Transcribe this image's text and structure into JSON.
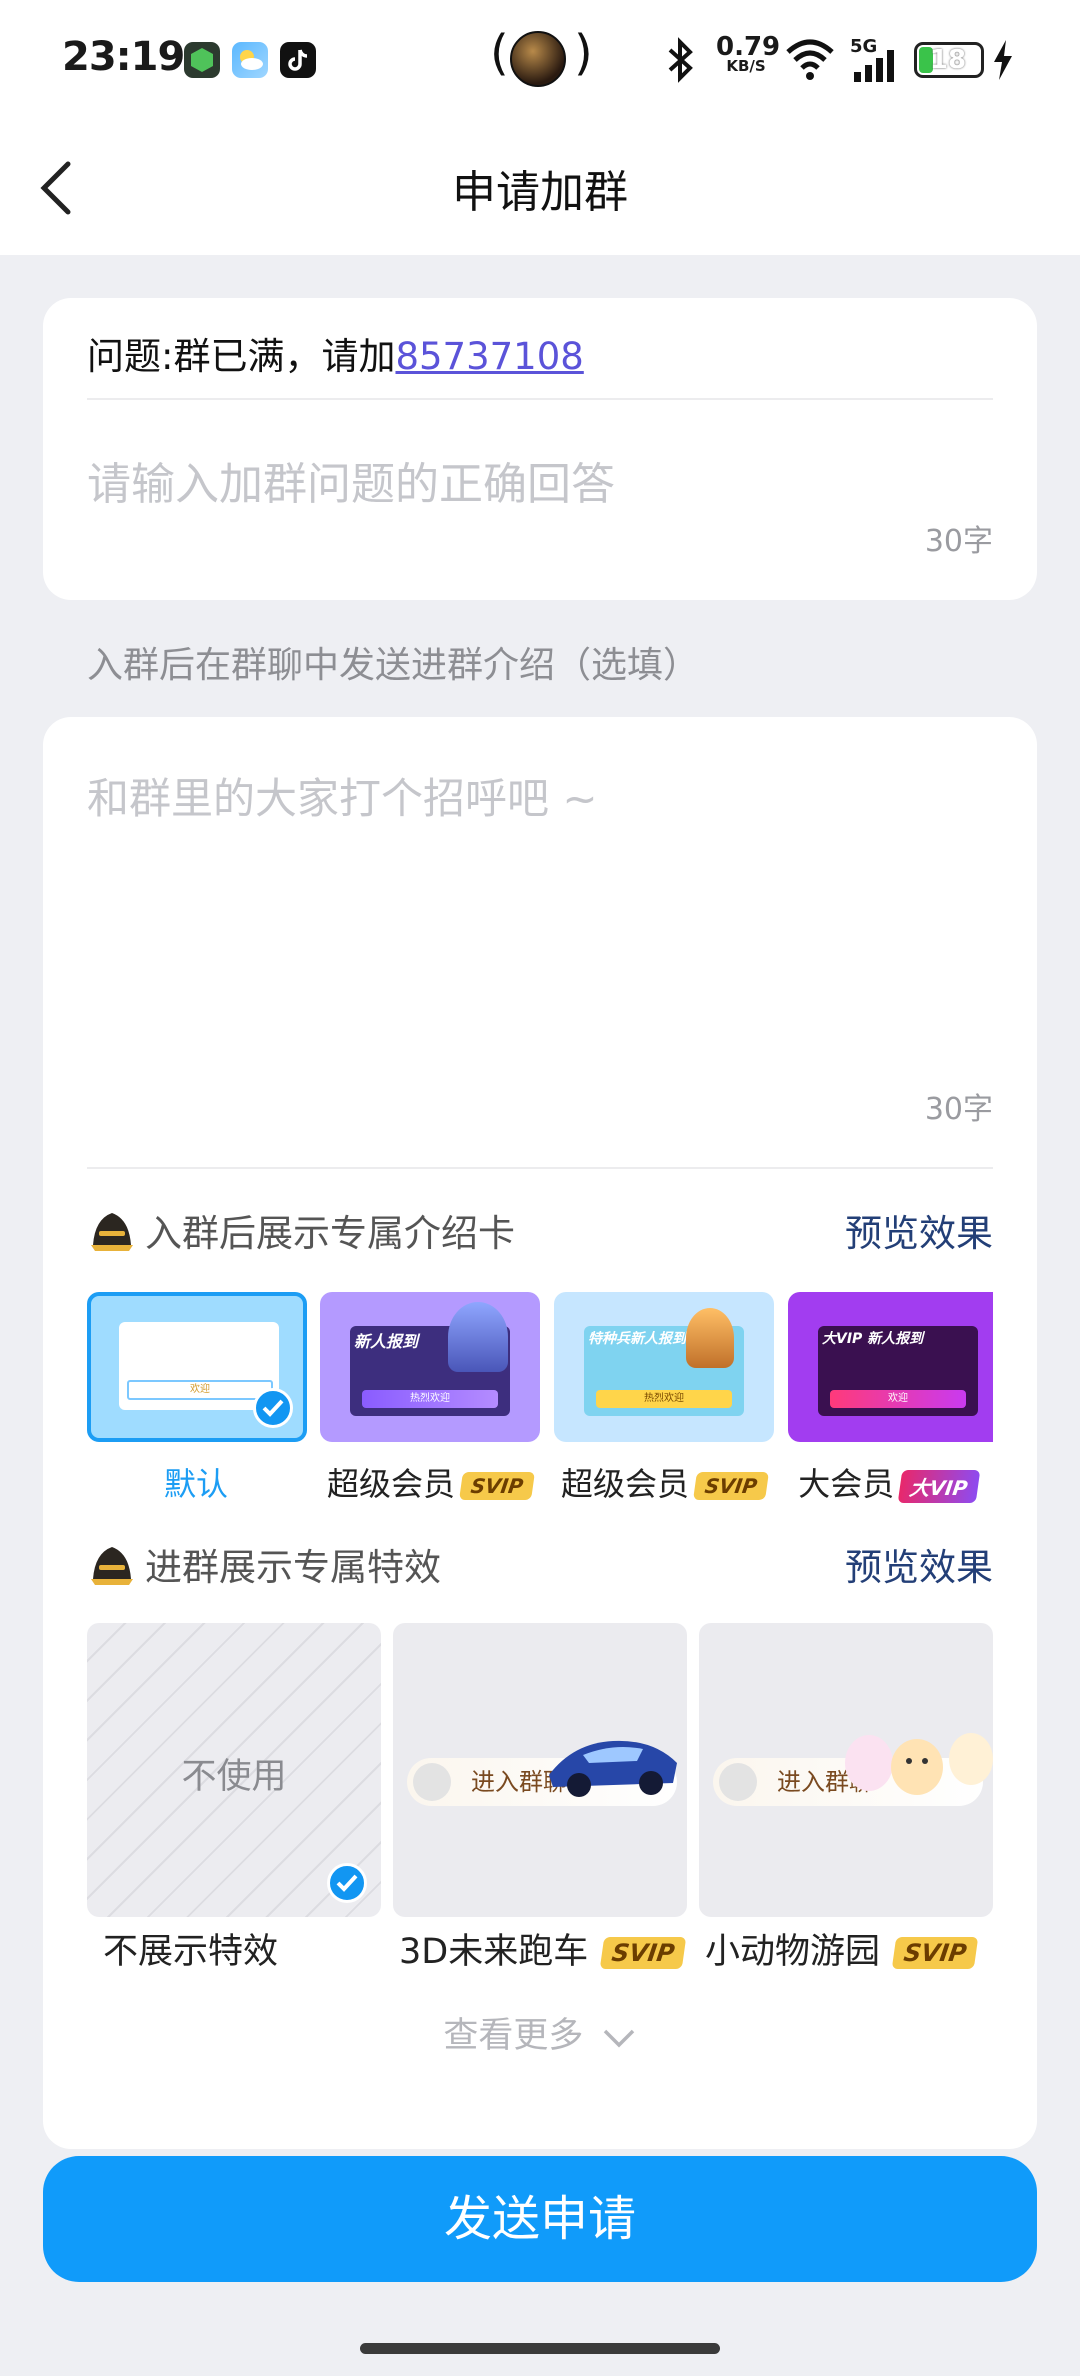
{
  "status_bar": {
    "time": "23:19",
    "speed_value": "0.79",
    "speed_unit": "KB/S",
    "network": "5G",
    "battery": "18"
  },
  "header": {
    "title": "申请加群"
  },
  "question_card": {
    "question_prefix": "问题:群已满，请加",
    "question_link": "85737108",
    "answer_placeholder": "请输入加群问题的正确回答",
    "answer_counter": "30字"
  },
  "intro_hint": "入群后在群聊中发送进群介绍（选填）",
  "intro_card": {
    "message_placeholder": "和群里的大家打个招呼吧 ~",
    "message_counter": "30字",
    "intro_card_section": {
      "title": "入群后展示专属介绍卡",
      "preview": "预览效果",
      "options": [
        {
          "label": "默认",
          "badge": "",
          "selected": true,
          "banner": "",
          "btn": "欢迎"
        },
        {
          "label": "超级会员",
          "badge": "SVIP",
          "banner": "新人报到",
          "btn": "热烈欢迎"
        },
        {
          "label": "超级会员",
          "badge": "SVIP",
          "banner": "特种兵新人报到",
          "btn": "热烈欢迎"
        },
        {
          "label": "大会员",
          "badge": "大VIP",
          "banner": "大VIP 新人报到",
          "btn": "欢迎"
        }
      ]
    },
    "effect_section": {
      "title": "进群展示专属特效",
      "preview": "预览效果",
      "options": [
        {
          "label": "不展示特效",
          "tile_text": "不使用",
          "badge": "",
          "selected": true
        },
        {
          "label": "3D未来跑车",
          "tile_text": "进入群聊",
          "badge": "SVIP"
        },
        {
          "label": "小动物游园",
          "tile_text": "进入群聊",
          "badge": "SVIP"
        }
      ]
    },
    "see_more": "查看更多"
  },
  "submit_button": "发送申请",
  "colors": {
    "accent": "#109bfa",
    "link": "#5b53d9",
    "preview": "#233f77",
    "svip": "#f6c94a"
  }
}
